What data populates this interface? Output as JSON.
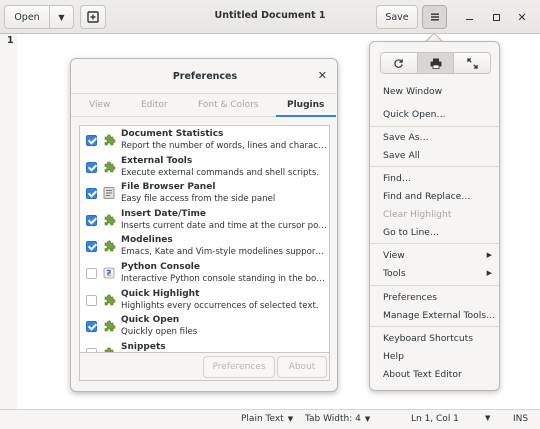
{
  "header": {
    "open_label": "Open",
    "title": "Untitled Document 1",
    "save_label": "Save"
  },
  "editor": {
    "line_number": "1"
  },
  "statusbar": {
    "language": "Plain Text",
    "tab_width": "Tab Width: 4",
    "position": "Ln 1, Col 1",
    "mode": "INS"
  },
  "preferences": {
    "title": "Preferences",
    "tabs": [
      "View",
      "Editor",
      "Font & Colors",
      "Plugins"
    ],
    "active_tab": "Plugins",
    "plugins": [
      {
        "name": "Document Statistics",
        "description": "Report the number of words, lines and charact…",
        "enabled": true,
        "icon": "puzzle-icon"
      },
      {
        "name": "External Tools",
        "description": "Execute external commands and shell scripts.",
        "enabled": true,
        "icon": "puzzle-icon"
      },
      {
        "name": "File Browser Panel",
        "description": "Easy file access from the side panel",
        "enabled": true,
        "icon": "file-manager-icon"
      },
      {
        "name": "Insert Date/Time",
        "description": "Inserts current date and time at the cursor posi…",
        "enabled": true,
        "icon": "puzzle-icon"
      },
      {
        "name": "Modelines",
        "description": "Emacs, Kate and Vim-style modelines support f…",
        "enabled": true,
        "icon": "puzzle-icon"
      },
      {
        "name": "Python Console",
        "description": "Interactive Python console standing in the bot…",
        "enabled": false,
        "icon": "python-icon"
      },
      {
        "name": "Quick Highlight",
        "description": "Highlights every occurrences of selected text.",
        "enabled": false,
        "icon": "puzzle-icon"
      },
      {
        "name": "Quick Open",
        "description": "Quickly open files",
        "enabled": true,
        "icon": "puzzle-icon"
      },
      {
        "name": "Snippets",
        "description": "",
        "enabled": false,
        "icon": "puzzle-icon"
      }
    ],
    "footer": {
      "preferences_label": "Preferences",
      "about_label": "About"
    }
  },
  "menu": {
    "icon_buttons": [
      "reload-icon",
      "print-icon",
      "fullscreen-icon"
    ],
    "items": {
      "new_window": "New Window",
      "quick_open": "Quick Open…",
      "save_as": "Save As…",
      "save_all": "Save All",
      "find": "Find…",
      "find_replace": "Find and Replace…",
      "clear_highlight": "Clear Highlight",
      "go_to_line": "Go to Line…",
      "view": "View",
      "tools": "Tools",
      "preferences": "Preferences",
      "manage_tools": "Manage External Tools…",
      "shortcuts": "Keyboard Shortcuts",
      "help": "Help",
      "about": "About Text Editor"
    }
  },
  "colors": {
    "accent": "#3584e4",
    "plugin_green": "#73a33a"
  }
}
